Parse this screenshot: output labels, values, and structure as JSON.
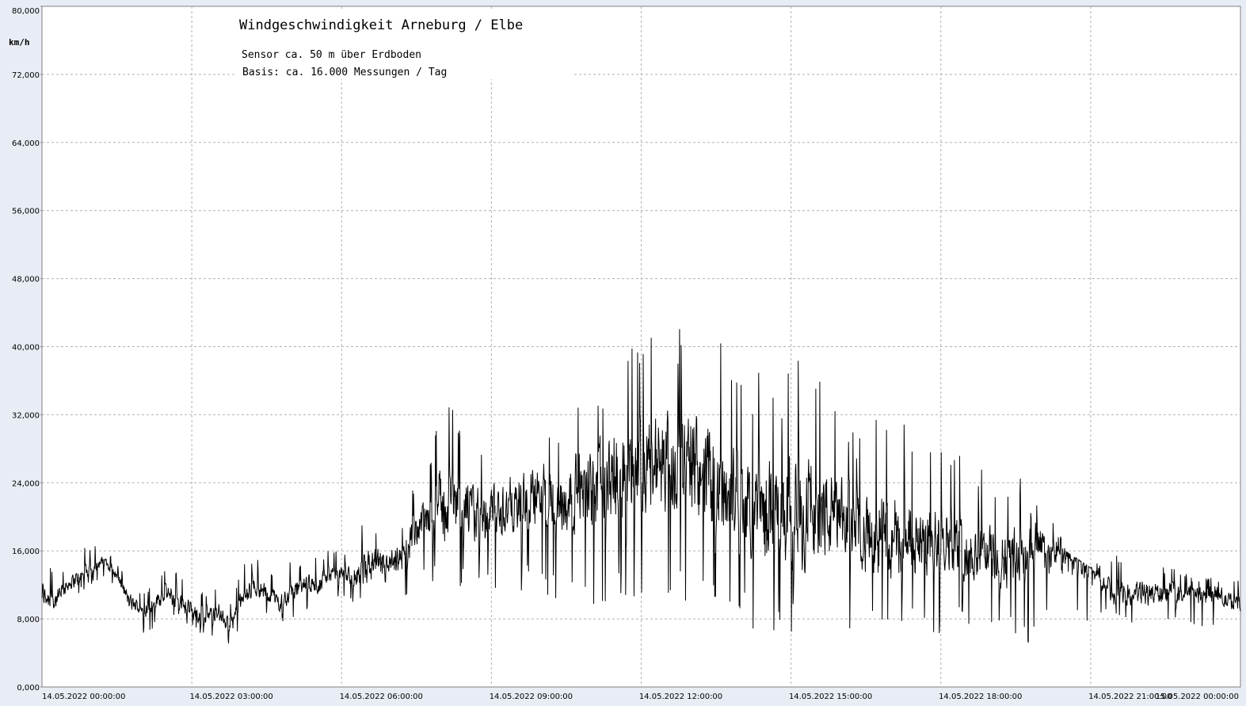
{
  "chart_data": {
    "type": "line",
    "title": "Windgeschwindigkeit  Arneburg / Elbe",
    "subtitle_lines": [
      "Sensor ca. 50 m über Erdboden",
      "Basis: ca. 16.000 Messungen / Tag"
    ],
    "ylabel": "km/h",
    "xlabel": "",
    "ylim": [
      0,
      80
    ],
    "yticks": [
      "0,000",
      "8,000",
      "16,000",
      "24,000",
      "32,000",
      "40,000",
      "48,000",
      "56,000",
      "64,000",
      "72,000",
      "80,000"
    ],
    "xticks": [
      "14.05.2022  00:00:00",
      "14.05.2022  03:00:00",
      "14.05.2022  06:00:00",
      "14.05.2022  09:00:00",
      "14.05.2022  12:00:00",
      "14.05.2022  15:00:00",
      "14.05.2022  18:00:00",
      "14.05.2022  21:00:00",
      "15.05.2022  00:00:00"
    ],
    "grid": true,
    "series": [
      {
        "x_hours": [
          0,
          0.25,
          0.5,
          0.75,
          1,
          1.25,
          1.5,
          1.75,
          2,
          2.25,
          2.5,
          2.75,
          3,
          3.25,
          3.5,
          3.75,
          4,
          4.25,
          4.5,
          4.75,
          5,
          5.25,
          5.5,
          5.75,
          6,
          6.25,
          6.5,
          6.75,
          7,
          7.25,
          7.5,
          7.75,
          8,
          8.25,
          8.5,
          8.75,
          9,
          9.25,
          9.5,
          9.75,
          10,
          10.25,
          10.5,
          10.75,
          11,
          11.25,
          11.5,
          11.75,
          12,
          12.25,
          12.5,
          12.75,
          13,
          13.25,
          13.5,
          13.75,
          14,
          14.25,
          14.5,
          14.75,
          15,
          15.25,
          15.5,
          15.75,
          16,
          16.25,
          16.5,
          16.75,
          17,
          17.25,
          17.5,
          17.75,
          18,
          18.25,
          18.5,
          18.75,
          19,
          19.25,
          19.5,
          19.75,
          20,
          20.25,
          20.5,
          20.75,
          21,
          21.25,
          21.5,
          21.75,
          22,
          22.25,
          22.5,
          22.75,
          23,
          23.25,
          23.5,
          23.75,
          24
        ],
        "mean": [
          11,
          10,
          12,
          13,
          14,
          15,
          13,
          10,
          9,
          10,
          11,
          10,
          9,
          8,
          9,
          7,
          10,
          12,
          11,
          10,
          11,
          12,
          12,
          13,
          13,
          13,
          14,
          14,
          14,
          15,
          19,
          20,
          21,
          22,
          21,
          20,
          20,
          21,
          21,
          22,
          23,
          22,
          22,
          23,
          23,
          24,
          25,
          24,
          25,
          26,
          26,
          26,
          26,
          25,
          24,
          23,
          22,
          21,
          20,
          20,
          20,
          21,
          21,
          20,
          19,
          19,
          18,
          18,
          17,
          17,
          17,
          17,
          18,
          17,
          16,
          16,
          16,
          15,
          15,
          16,
          16,
          16,
          15,
          15,
          14,
          12,
          11,
          11,
          11,
          11,
          11,
          11,
          11,
          11,
          11,
          10,
          10,
          10,
          11
        ],
        "min": [
          6,
          7,
          9,
          11,
          12,
          13,
          11,
          7,
          6,
          7,
          8,
          8,
          7,
          6,
          6,
          5,
          7,
          9,
          8,
          7,
          8,
          9,
          9,
          10,
          10,
          10,
          9,
          8,
          8,
          9,
          12,
          12,
          13,
          12,
          11,
          10,
          11,
          10,
          10,
          12,
          11,
          10,
          10,
          9,
          9,
          9,
          9,
          9,
          8,
          9,
          10,
          10,
          9,
          9,
          8,
          8,
          7,
          6,
          5,
          6,
          6,
          5,
          5,
          4,
          4,
          5,
          5,
          6,
          6,
          7,
          7,
          6,
          6,
          7,
          7,
          6,
          6,
          6,
          5,
          5,
          7,
          7,
          6,
          7,
          7,
          8,
          8,
          7,
          7,
          7,
          7,
          7,
          7,
          7,
          7,
          7,
          7,
          8,
          8
        ],
        "max": [
          15,
          14,
          14,
          16,
          17,
          16,
          15,
          12,
          11,
          12,
          14,
          14,
          13,
          11,
          12,
          10,
          14,
          16,
          14,
          13,
          15,
          15,
          16,
          16,
          16,
          17,
          21,
          19,
          18,
          20,
          25,
          26,
          36,
          34,
          30,
          29,
          30,
          29,
          28,
          30,
          30,
          31,
          32,
          33,
          35,
          36,
          39,
          41,
          42,
          43,
          44,
          42,
          43,
          44,
          43,
          40,
          38,
          36,
          40,
          35,
          39,
          41,
          40,
          34,
          33,
          30,
          30,
          33,
          35,
          34,
          29,
          28,
          28,
          27,
          28,
          26,
          25,
          25,
          26,
          22,
          22,
          20,
          16,
          15,
          14,
          15,
          16,
          14,
          15,
          15,
          14,
          14,
          13,
          13,
          13,
          13,
          13,
          13,
          12
        ]
      }
    ]
  }
}
